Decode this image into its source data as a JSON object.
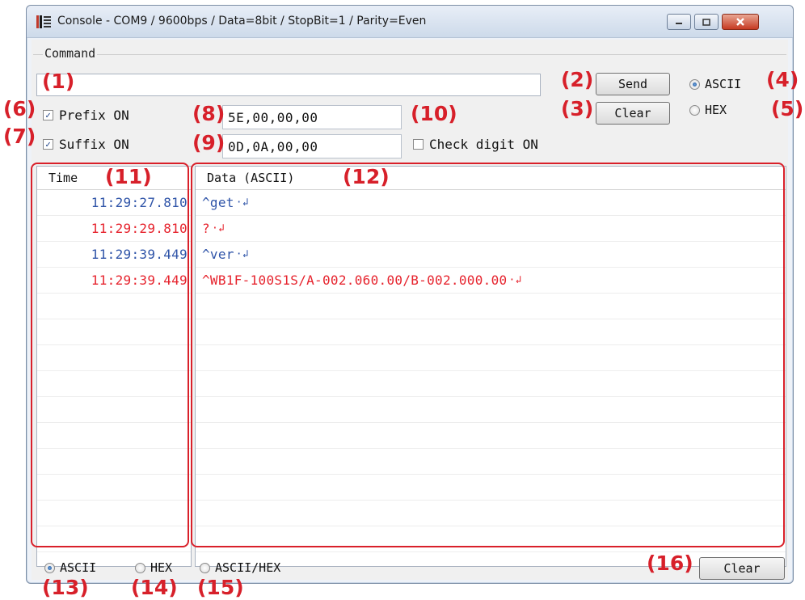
{
  "window": {
    "title": "Console - COM9 / 9600bps / Data=8bit / StopBit=1 / Parity=Even"
  },
  "command": {
    "group_label": "Command",
    "input_value": "",
    "send_label": "Send",
    "clear_label": "Clear",
    "mode_ascii_label": "ASCII",
    "mode_hex_label": "HEX",
    "mode_selected": "ASCII",
    "prefix": {
      "label": "Prefix ON",
      "checked": true,
      "value": "5E,00,00,00"
    },
    "suffix": {
      "label": "Suffix ON",
      "checked": true,
      "value": "0D,0A,00,00"
    },
    "check_digit": {
      "label": "Check digit ON",
      "checked": false
    }
  },
  "log": {
    "time_header": "Time",
    "data_header": "Data (ASCII)",
    "rows": [
      {
        "time": "11:29:27.810",
        "data": "^get",
        "color": "#2f54a8"
      },
      {
        "time": "11:29:29.810",
        "data": "?",
        "color": "#e6232d"
      },
      {
        "time": "11:29:39.449",
        "data": "^ver",
        "color": "#2f54a8"
      },
      {
        "time": "11:29:39.449",
        "data": "^WB1F-100S1S/A-002.060.00/B-002.000.00",
        "color": "#e6232d"
      }
    ],
    "empty_rows": 10
  },
  "display_mode": {
    "ascii_label": "ASCII",
    "hex_label": "HEX",
    "ascii_hex_label": "ASCII/HEX",
    "selected": "ASCII",
    "clear_label": "Clear"
  },
  "annotations": {
    "a1": "(1)",
    "a2": "(2)",
    "a3": "(3)",
    "a4": "(4)",
    "a5": "(5)",
    "a6": "(6)",
    "a7": "(7)",
    "a8": "(8)",
    "a9": "(9)",
    "a10": "(10)",
    "a11": "(11)",
    "a12": "(12)",
    "a13": "(13)",
    "a14": "(14)",
    "a15": "(15)",
    "a16": "(16)"
  },
  "colors": {
    "annotation": "#d7202a",
    "sent_text": "#2f54a8",
    "received_text": "#e6232d"
  }
}
